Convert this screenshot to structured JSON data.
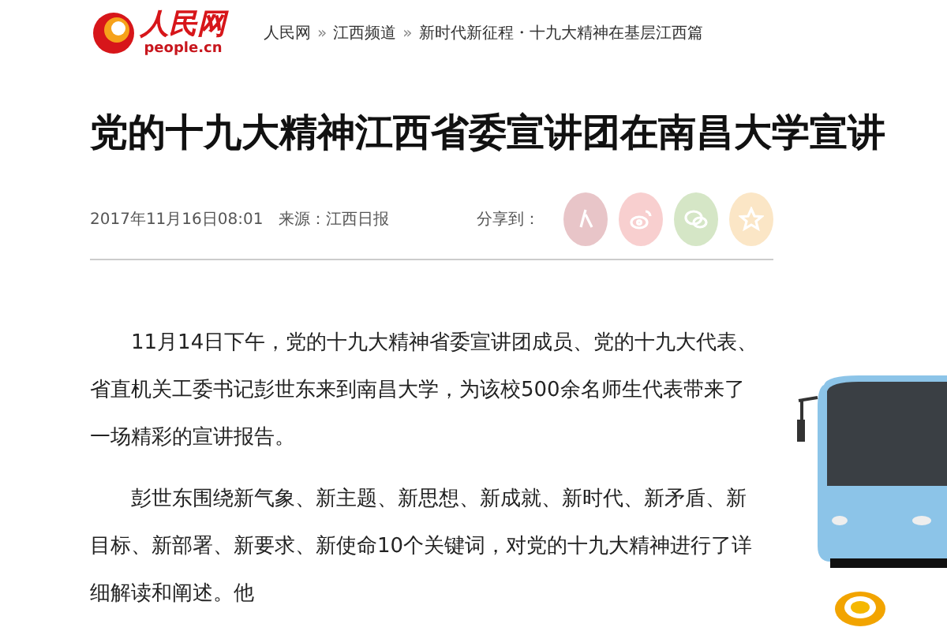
{
  "logo": {
    "name": "人民网",
    "domain": "people.cn"
  },
  "breadcrumb": [
    {
      "kind": "link",
      "text": "人民网"
    },
    {
      "kind": "separator",
      "text": "»"
    },
    {
      "kind": "link",
      "text": "江西频道"
    },
    {
      "kind": "separator",
      "text": "»"
    },
    {
      "kind": "link",
      "text": "新时代新征程・十九大精神在基层江西篇"
    }
  ],
  "article": {
    "title": "党的十九大精神江西省委宣讲团在南昌大学宣讲",
    "date": "2017年11月16日08:01",
    "source": "来源：江西日报",
    "share_label": "分享到：",
    "share_buttons": [
      {
        "kind": "people",
        "color": "#e8c5c8"
      },
      {
        "kind": "weibo",
        "color": "#f8cfcf"
      },
      {
        "kind": "wechat",
        "color": "#d5e6c6"
      },
      {
        "kind": "qzone",
        "color": "#fbe6c6"
      }
    ],
    "paragraphs": [
      "11月14日下午，党的十九大精神省委宣讲团成员、党的十九大代表、省直机关工委书记彭世东来到南昌大学，为该校500余名师生代表带来了一场精彩的宣讲报告。",
      "彭世东围绕新气象、新主题、新思想、新成就、新时代、新矛盾、新目标、新部署、新要求、新使命10个关键词，对党的十九大精神进行了详细解读和阐述。他"
    ]
  }
}
